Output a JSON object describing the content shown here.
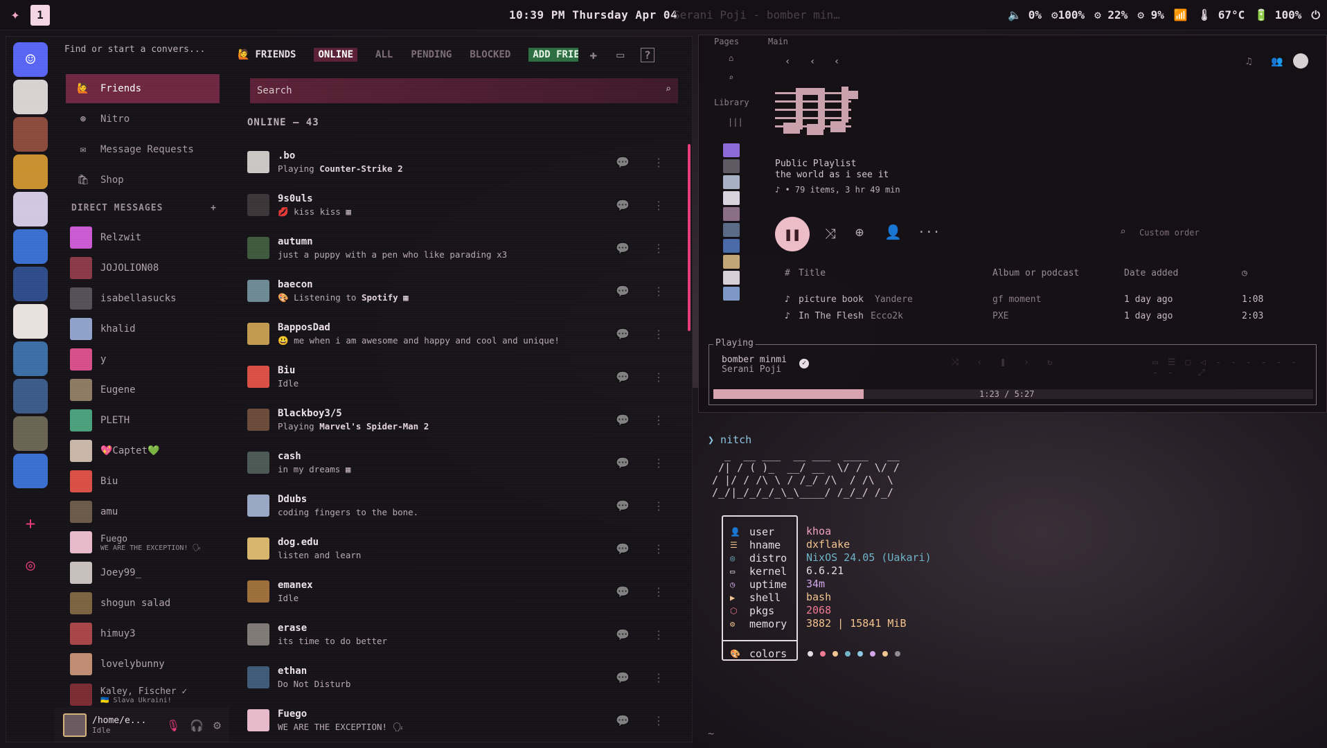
{
  "topbar": {
    "workspace": "1",
    "clock": "10:39 PM  Thursday Apr 04",
    "now_playing": "Serani Poji - bomber min…",
    "stats": [
      "🔈 0%",
      "⚙100%",
      "⚙ 22%",
      "⚙ 9%",
      "📶",
      "🌡 67°C",
      "🔋 100%",
      "⏻"
    ]
  },
  "discord": {
    "find_placeholder": "Find or start a convers...",
    "tabs": {
      "friends": "FRIENDS",
      "online": "ONLINE",
      "all": "ALL",
      "pending": "PENDING",
      "blocked": "BLOCKED",
      "add": "ADD FRIEND"
    },
    "nav": [
      {
        "label": "Friends",
        "icon": "friends-icon"
      },
      {
        "label": "Nitro",
        "icon": "nitro-icon"
      },
      {
        "label": "Message Requests",
        "icon": "mail-icon"
      },
      {
        "label": "Shop",
        "icon": "shop-icon"
      }
    ],
    "dm_header": "DIRECT MESSAGES",
    "dm_add": "+",
    "dms": [
      {
        "name": "Relzwit",
        "color": "#c95ad1"
      },
      {
        "name": "JOJOLION08",
        "color": "#8a3a46"
      },
      {
        "name": "isabellasucks",
        "color": "#555058"
      },
      {
        "name": "khalid",
        "color": "#8fa2c9"
      },
      {
        "name": "y",
        "color": "#d74f8a"
      },
      {
        "name": "Eugene",
        "color": "#8c7a62"
      },
      {
        "name": "PLETH",
        "color": "#4aa07b"
      },
      {
        "name": "💖Captet💚",
        "color": "#c9b6a8"
      },
      {
        "name": "Biu",
        "color": "#d94f45"
      },
      {
        "name": "amu",
        "color": "#6b5a48"
      },
      {
        "name": "Fuego",
        "sub": "WE ARE THE EXCEPTION! 🗣",
        "color": "#e8b9c9"
      },
      {
        "name": "Joey99_",
        "color": "#c7c0bd"
      },
      {
        "name": "shogun salad",
        "color": "#7a6340"
      },
      {
        "name": "himuy3",
        "color": "#a84548"
      },
      {
        "name": "lovelybunny",
        "color": "#c08c72"
      },
      {
        "name": "Kaley, Fischer ✓",
        "sub": "🇺🇦 Slava Ukraini!",
        "color": "#7b2b34"
      }
    ],
    "user": {
      "name": "/home/e...",
      "status": "Idle"
    },
    "search_placeholder": "Search",
    "online_header": "ONLINE — 43",
    "friends": [
      {
        "name": ".bo",
        "prefix": "Playing ",
        "status": "Counter-Strike 2",
        "color": "#c9c6c4"
      },
      {
        "name": "9s0uls",
        "prefix": "💋 kiss kiss ▦",
        "status": "",
        "color": "#3c3538"
      },
      {
        "name": "autumn",
        "prefix": "just a puppy with a pen who like parading x3",
        "status": "",
        "color": "#3e5a3d"
      },
      {
        "name": "baecon",
        "prefix": "🎨 Listening to ",
        "status": "Spotify ▦",
        "color": "#6d8a94"
      },
      {
        "name": "BapposDad",
        "prefix": "😃 me when i am awesome and happy and cool and unique!",
        "status": "",
        "color": "#c29a4f"
      },
      {
        "name": "Biu",
        "prefix": "Idle",
        "status": "",
        "color": "#d94f45"
      },
      {
        "name": "Blackboy3/5",
        "prefix": "Playing ",
        "status": "Marvel's Spider-Man 2",
        "color": "#6b4a3a"
      },
      {
        "name": "cash",
        "prefix": "in my dreams ▦",
        "status": "",
        "color": "#4c5854"
      },
      {
        "name": "Ddubs",
        "prefix": "coding fingers to the bone.",
        "status": "",
        "color": "#9aa7c4"
      },
      {
        "name": "dog.edu",
        "prefix": "listen and learn",
        "status": "",
        "color": "#d7b56d"
      },
      {
        "name": "emanex",
        "prefix": "Idle",
        "status": "",
        "color": "#9c6f3a"
      },
      {
        "name": "erase",
        "prefix": "its time to do better",
        "status": "",
        "color": "#7f7a76"
      },
      {
        "name": "ethan",
        "prefix": "Do Not Disturb",
        "status": "",
        "color": "#3f5a78"
      },
      {
        "name": "Fuego",
        "prefix": "WE ARE THE EXCEPTION! 🗣",
        "status": "",
        "color": "#e8b9c9"
      }
    ]
  },
  "spotify": {
    "pages": "Pages",
    "main": "Main",
    "library": "Library",
    "playlist_type": "Public Playlist",
    "playlist_name": "the world as i see it",
    "playlist_meta": "♪ • 79 items, 3 hr 49 min",
    "custom_order": "Custom order",
    "cols": {
      "num": "#",
      "title": "Title",
      "album": "Album or podcast",
      "date": "Date added"
    },
    "tracks": [
      {
        "title": "picture book",
        "artist": "Yandere",
        "album": "gf moment",
        "date": "1 day ago",
        "dur": "1:08"
      },
      {
        "title": "In The Flesh",
        "artist": "Ecco2k",
        "album": "PXE",
        "date": "1 day ago",
        "dur": "2:03"
      }
    ],
    "playing_label": "Playing",
    "now_title": "bomber minmi",
    "now_artist": "Serani Poji",
    "time": "1:23 / 5:27",
    "progress": 0.25
  },
  "terminal": {
    "prompt": "❯ nitch",
    "ascii": "  _  __ ___  __ ___  ____   __\n /| / ( )_  __/ __  \\/ /  \\/ /\n/ |/ / /\\ \\ / /_/ /\\  / /\\  \\ \n/_/|_/_/_/_\\_\\____/ /_/_/ /_/",
    "rows": [
      {
        "key": "user",
        "val": "khoa",
        "icon": "user-icon",
        "ic": "👤",
        "color": "#f0a3c0"
      },
      {
        "key": "hname",
        "val": "dxflake",
        "icon": "hostname-icon",
        "ic": "☰",
        "color": "#f2c48f"
      },
      {
        "key": "distro",
        "val": "NixOS 24.05 (Uakari)",
        "icon": "distro-icon",
        "ic": "◎",
        "color": "#6fb4c8"
      },
      {
        "key": "kernel",
        "val": "6.6.21",
        "icon": "kernel-icon",
        "ic": "▭",
        "color": "#e6dbe0"
      },
      {
        "key": "uptime",
        "val": "34m",
        "icon": "uptime-icon",
        "ic": "◷",
        "color": "#cfa7e8"
      },
      {
        "key": "shell",
        "val": "bash",
        "icon": "shell-icon",
        "ic": "▶",
        "color": "#f2c48f"
      },
      {
        "key": "pkgs",
        "val": "2068",
        "icon": "packages-icon",
        "ic": "⬡",
        "color": "#f07b91"
      },
      {
        "key": "memory",
        "val": "3882 | 15841 MiB",
        "icon": "memory-icon",
        "ic": "⚙",
        "color": "#f2c48f"
      }
    ],
    "colors_label": "colors",
    "palette": [
      "#e6dbe0",
      "#f07b91",
      "#f2c48f",
      "#6fb4c8",
      "#8ec5e0",
      "#cfa7e8",
      "#f2c48f",
      "#8d8b96"
    ],
    "cwd": "~"
  }
}
